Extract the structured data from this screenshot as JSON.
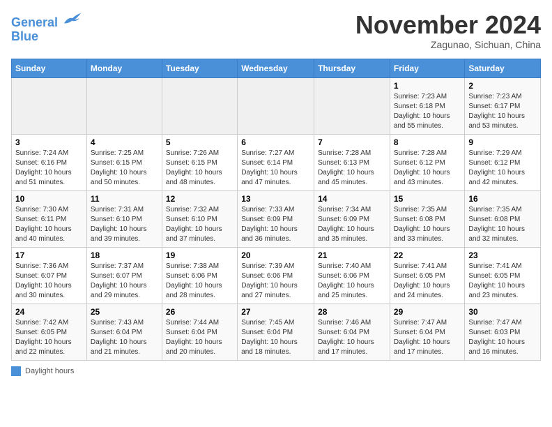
{
  "logo": {
    "line1": "General",
    "line2": "Blue"
  },
  "title": "November 2024",
  "subtitle": "Zagunao, Sichuan, China",
  "days_of_week": [
    "Sunday",
    "Monday",
    "Tuesday",
    "Wednesday",
    "Thursday",
    "Friday",
    "Saturday"
  ],
  "weeks": [
    [
      {
        "day": "",
        "empty": true
      },
      {
        "day": "",
        "empty": true
      },
      {
        "day": "",
        "empty": true
      },
      {
        "day": "",
        "empty": true
      },
      {
        "day": "",
        "empty": true
      },
      {
        "day": "1",
        "sunrise": "7:23 AM",
        "sunset": "6:18 PM",
        "daylight": "10 hours and 55 minutes."
      },
      {
        "day": "2",
        "sunrise": "7:23 AM",
        "sunset": "6:17 PM",
        "daylight": "10 hours and 53 minutes."
      }
    ],
    [
      {
        "day": "3",
        "sunrise": "7:24 AM",
        "sunset": "6:16 PM",
        "daylight": "10 hours and 51 minutes."
      },
      {
        "day": "4",
        "sunrise": "7:25 AM",
        "sunset": "6:15 PM",
        "daylight": "10 hours and 50 minutes."
      },
      {
        "day": "5",
        "sunrise": "7:26 AM",
        "sunset": "6:15 PM",
        "daylight": "10 hours and 48 minutes."
      },
      {
        "day": "6",
        "sunrise": "7:27 AM",
        "sunset": "6:14 PM",
        "daylight": "10 hours and 47 minutes."
      },
      {
        "day": "7",
        "sunrise": "7:28 AM",
        "sunset": "6:13 PM",
        "daylight": "10 hours and 45 minutes."
      },
      {
        "day": "8",
        "sunrise": "7:28 AM",
        "sunset": "6:12 PM",
        "daylight": "10 hours and 43 minutes."
      },
      {
        "day": "9",
        "sunrise": "7:29 AM",
        "sunset": "6:12 PM",
        "daylight": "10 hours and 42 minutes."
      }
    ],
    [
      {
        "day": "10",
        "sunrise": "7:30 AM",
        "sunset": "6:11 PM",
        "daylight": "10 hours and 40 minutes."
      },
      {
        "day": "11",
        "sunrise": "7:31 AM",
        "sunset": "6:10 PM",
        "daylight": "10 hours and 39 minutes."
      },
      {
        "day": "12",
        "sunrise": "7:32 AM",
        "sunset": "6:10 PM",
        "daylight": "10 hours and 37 minutes."
      },
      {
        "day": "13",
        "sunrise": "7:33 AM",
        "sunset": "6:09 PM",
        "daylight": "10 hours and 36 minutes."
      },
      {
        "day": "14",
        "sunrise": "7:34 AM",
        "sunset": "6:09 PM",
        "daylight": "10 hours and 35 minutes."
      },
      {
        "day": "15",
        "sunrise": "7:35 AM",
        "sunset": "6:08 PM",
        "daylight": "10 hours and 33 minutes."
      },
      {
        "day": "16",
        "sunrise": "7:35 AM",
        "sunset": "6:08 PM",
        "daylight": "10 hours and 32 minutes."
      }
    ],
    [
      {
        "day": "17",
        "sunrise": "7:36 AM",
        "sunset": "6:07 PM",
        "daylight": "10 hours and 30 minutes."
      },
      {
        "day": "18",
        "sunrise": "7:37 AM",
        "sunset": "6:07 PM",
        "daylight": "10 hours and 29 minutes."
      },
      {
        "day": "19",
        "sunrise": "7:38 AM",
        "sunset": "6:06 PM",
        "daylight": "10 hours and 28 minutes."
      },
      {
        "day": "20",
        "sunrise": "7:39 AM",
        "sunset": "6:06 PM",
        "daylight": "10 hours and 27 minutes."
      },
      {
        "day": "21",
        "sunrise": "7:40 AM",
        "sunset": "6:06 PM",
        "daylight": "10 hours and 25 minutes."
      },
      {
        "day": "22",
        "sunrise": "7:41 AM",
        "sunset": "6:05 PM",
        "daylight": "10 hours and 24 minutes."
      },
      {
        "day": "23",
        "sunrise": "7:41 AM",
        "sunset": "6:05 PM",
        "daylight": "10 hours and 23 minutes."
      }
    ],
    [
      {
        "day": "24",
        "sunrise": "7:42 AM",
        "sunset": "6:05 PM",
        "daylight": "10 hours and 22 minutes."
      },
      {
        "day": "25",
        "sunrise": "7:43 AM",
        "sunset": "6:04 PM",
        "daylight": "10 hours and 21 minutes."
      },
      {
        "day": "26",
        "sunrise": "7:44 AM",
        "sunset": "6:04 PM",
        "daylight": "10 hours and 20 minutes."
      },
      {
        "day": "27",
        "sunrise": "7:45 AM",
        "sunset": "6:04 PM",
        "daylight": "10 hours and 18 minutes."
      },
      {
        "day": "28",
        "sunrise": "7:46 AM",
        "sunset": "6:04 PM",
        "daylight": "10 hours and 17 minutes."
      },
      {
        "day": "29",
        "sunrise": "7:47 AM",
        "sunset": "6:04 PM",
        "daylight": "10 hours and 17 minutes."
      },
      {
        "day": "30",
        "sunrise": "7:47 AM",
        "sunset": "6:03 PM",
        "daylight": "10 hours and 16 minutes."
      }
    ]
  ],
  "legend": {
    "label": "Daylight hours"
  }
}
